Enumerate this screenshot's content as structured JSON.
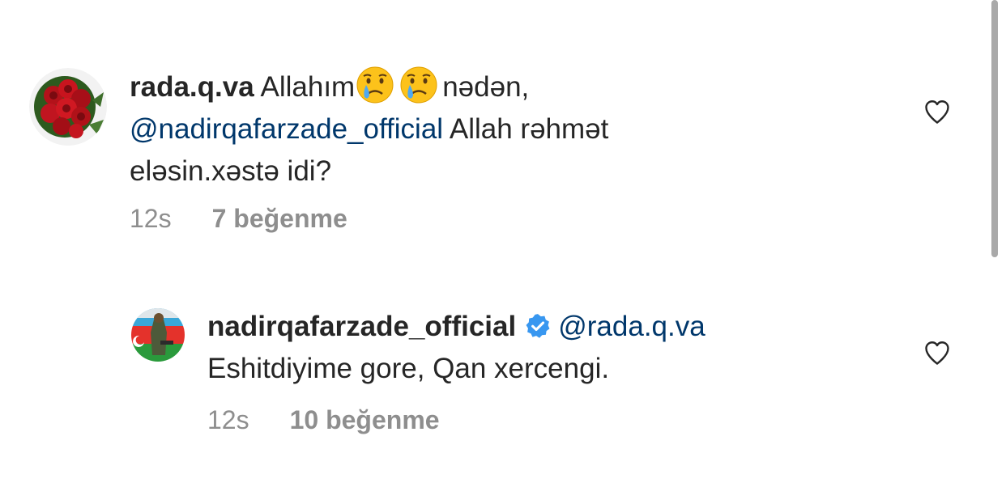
{
  "comments": [
    {
      "username": "rada.q.va",
      "text_part1": " Allahım",
      "emoji_icons": [
        "crying-face-icon",
        "crying-face-icon"
      ],
      "text_part2": "nədən,",
      "mention": "@nadirqafarzade_official",
      "text_part3": " Allah rəhmət",
      "text_part4": "eləsin.xəstə idi?",
      "time": "12s",
      "likes": "7 beğenme"
    },
    {
      "username": "nadirqafarzade_official",
      "verified": true,
      "mention": "@rada.q.va",
      "text": "Eshitdiyime gore, Qan xercengi.",
      "time": "12s",
      "likes": "10 beğenme"
    }
  ],
  "colors": {
    "mention": "#00376b",
    "meta": "#8e8e8e",
    "verified": "#3897f0",
    "text": "#262626"
  }
}
